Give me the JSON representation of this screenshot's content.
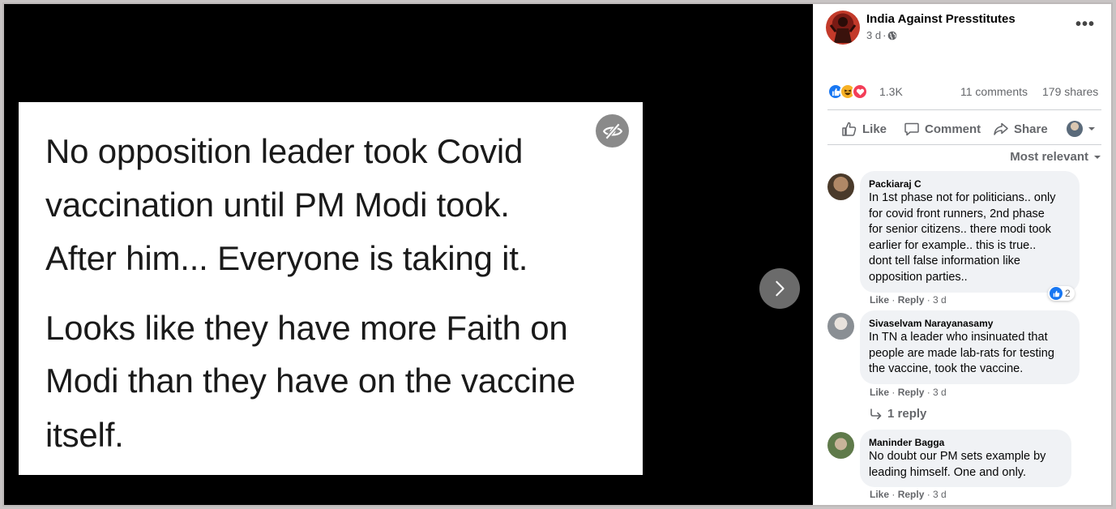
{
  "photo": {
    "lines": [
      "No opposition leader took Covid",
      "vaccination until PM Modi  took.",
      "After him... Everyone is taking it.",
      "Looks like they have more Faith on",
      "Modi than they have on the vaccine",
      "itself."
    ]
  },
  "post": {
    "page_name": "India Against Presstitutes",
    "time": "3 d",
    "visibility_icon": "globe-icon",
    "more_label": "•••"
  },
  "stats": {
    "reaction_count": "1.3K",
    "comments": "11 comments",
    "shares": "179 shares",
    "reaction_types": [
      "like",
      "haha",
      "love"
    ]
  },
  "actions": {
    "like": "Like",
    "comment": "Comment",
    "share": "Share"
  },
  "sort": {
    "label": "Most relevant"
  },
  "comments": [
    {
      "author": "Packiaraj C",
      "text": "In 1st phase not for politicians.. only\nfor covid front runners, 2nd phase\nfor senior citizens.. there modi took\nearlier for example.. this is true..\ndont tell false information like\nopposition parties..",
      "like_label": "Like",
      "reply_label": "Reply",
      "time": "3 d",
      "reaction_count": "2"
    },
    {
      "author": "Sivaselvam Narayanasamy",
      "text": "In TN a leader who insinuated that\npeople are made lab-rats for testing\nthe vaccine, took the vaccine.",
      "like_label": "Like",
      "reply_label": "Reply",
      "time": "3 d",
      "replies_label": "1 reply"
    },
    {
      "author": "Maninder Bagga",
      "text": "No doubt our PM sets example by\nleading himself. One and only.",
      "like_label": "Like",
      "reply_label": "Reply",
      "time": "3 d"
    }
  ],
  "colors": {
    "viewer_bg": "#000000",
    "like_blue": "#1877f2",
    "love_red": "#f33e58",
    "haha_yellow": "#f7b125",
    "meta_gray": "#65676b",
    "bubble_bg": "#f0f2f5"
  }
}
